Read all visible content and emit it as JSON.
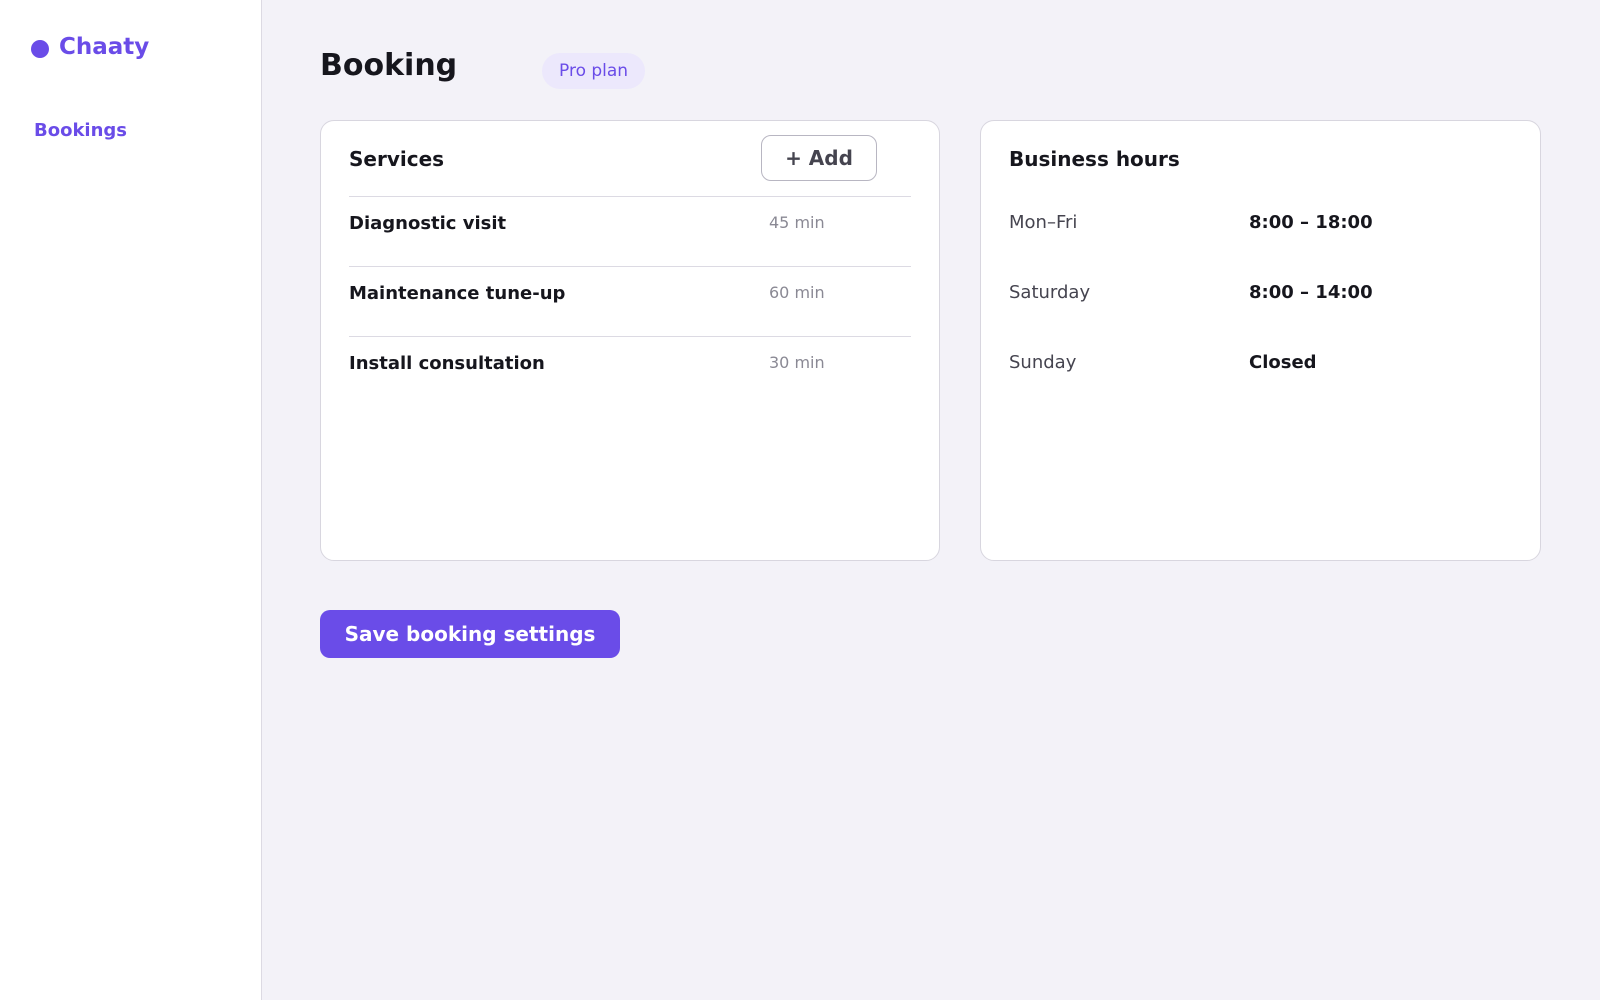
{
  "sidebar": {
    "brand": "Chaaty",
    "nav_items": [
      {
        "label": "Bookings",
        "active": true
      }
    ]
  },
  "header": {
    "title": "Booking",
    "plan_badge": "Pro plan"
  },
  "services_card": {
    "title": "Services",
    "add_label": "+ Add",
    "items": [
      {
        "name": "Diagnostic visit",
        "duration": "45 min"
      },
      {
        "name": "Maintenance tune-up",
        "duration": "60 min"
      },
      {
        "name": "Install consultation",
        "duration": "30 min"
      }
    ]
  },
  "hours_card": {
    "title": "Business hours",
    "rows": [
      {
        "day": "Mon–Fri",
        "hours": "8:00 – 18:00"
      },
      {
        "day": "Saturday",
        "hours": "8:00 – 14:00"
      },
      {
        "day": "Sunday",
        "hours": "Closed"
      }
    ]
  },
  "actions": {
    "save_label": "Save booking settings"
  },
  "colors": {
    "accent": "#6a4ce8",
    "background": "#f3f2f8",
    "badge_bg": "#ece8fc"
  }
}
